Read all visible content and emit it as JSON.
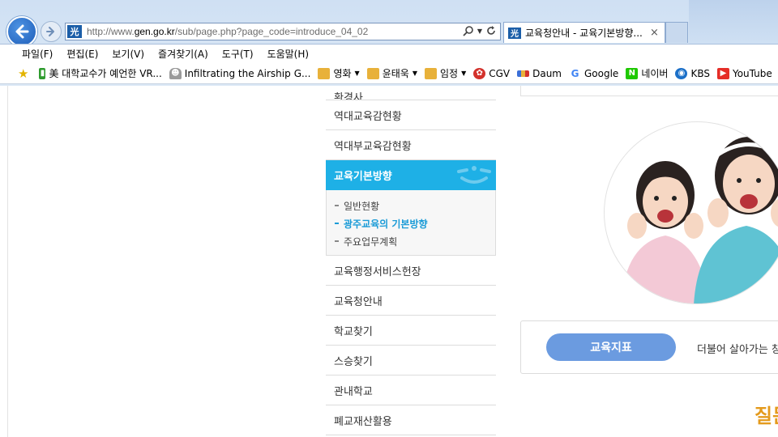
{
  "browser": {
    "address_url": "http://www.gen.go.kr/sub/page.php?page_code=introduce_04_02",
    "address_prefix": "http://www.",
    "address_domain": "gen.go.kr",
    "address_path": "/sub/page.php?page_code=introduce_04_02",
    "tab_title": "교육청안내 - 교육기본방향...",
    "tab_close": "×",
    "favicon_glyph": "光"
  },
  "menubar": [
    "파일(F)",
    "편집(E)",
    "보기(V)",
    "즐겨찾기(A)",
    "도구(T)",
    "도움말(H)"
  ],
  "favorites": [
    {
      "label": "美 대학교수가 예언한 VR...",
      "icon": "bookmark-icon",
      "color": "#2e9b2e"
    },
    {
      "label": "Infiltrating the Airship",
      "icon": "ghost-icon",
      "color": "#888888"
    },
    {
      "label": "G...",
      "icon": "none",
      "color": ""
    },
    {
      "label": "영화",
      "icon": "folder-icon",
      "color": "#e8b13a",
      "dropdown": true
    },
    {
      "label": "윤태욱",
      "icon": "folder-icon",
      "color": "#e8b13a",
      "dropdown": true
    },
    {
      "label": "임정",
      "icon": "folder-icon",
      "color": "#e8b13a",
      "dropdown": true
    },
    {
      "label": "CGV",
      "icon": "cgv-icon",
      "color": "#d3322c"
    },
    {
      "label": "Daum",
      "icon": "daum-icon",
      "color": "#3b6fd8"
    },
    {
      "label": "Google",
      "icon": "google-icon",
      "color": "#4285f4"
    },
    {
      "label": "네이버",
      "icon": "naver-icon",
      "color": "#1ec800"
    },
    {
      "label": "KBS",
      "icon": "kbs-icon",
      "color": "#1c70c8"
    },
    {
      "label": "YouTube",
      "icon": "youtube-icon",
      "color": "#e52d27"
    }
  ],
  "side_menu": {
    "top_cut_label": "환경사",
    "items_before": [
      "역대교육감현황",
      "역대부교육감현황"
    ],
    "active_label": "교육기본방향",
    "submenu": [
      {
        "label": "일반현황",
        "active": false
      },
      {
        "label": "광주교육의 기본방향",
        "active": true
      },
      {
        "label": "주요업무계획",
        "active": false
      }
    ],
    "items_after": [
      "교육행정서비스헌장",
      "교육청안내",
      "학교찾기",
      "스승찾기",
      "관내학교",
      "폐교재산활용"
    ]
  },
  "content": {
    "goal_button": "교육지표",
    "goal_text": "더불어 살아가는 창",
    "corner_text": "질문"
  },
  "colors": {
    "active_menu_bg": "#1eb0e6",
    "active_sub_text": "#1a9bd7",
    "goal_button_bg": "#6b9be0",
    "corner_text": "#e49a1c"
  }
}
